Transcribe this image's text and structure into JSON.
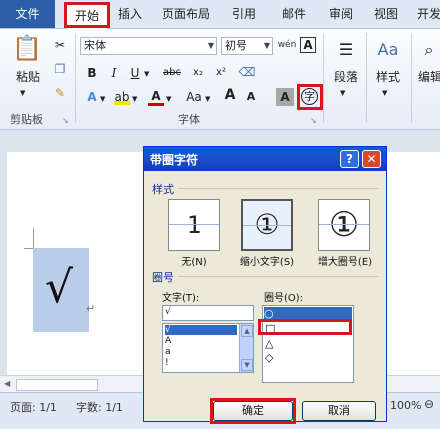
{
  "tabs": [
    "文件",
    "开始",
    "插入",
    "页面布局",
    "引用",
    "邮件",
    "审阅",
    "视图",
    "开发"
  ],
  "ribbon": {
    "clipboard": {
      "paste_label": "粘贴",
      "group_label": "剪贴板"
    },
    "font": {
      "font_name": "宋体",
      "font_size": "初号",
      "wen_icon": "wén",
      "a_box_icon": "A",
      "bold": "B",
      "italic": "I",
      "underline": "U",
      "strikethrough": "abc",
      "subscript": "x₂",
      "superscript": "x²",
      "aa": "Aa",
      "grow": "A",
      "shrink": "A",
      "char_shading": "A",
      "enclose_char": "字",
      "group_label": "字体"
    },
    "paragraph_label": "段落",
    "styles_label": "样式",
    "edit_label": "编辑"
  },
  "document": {
    "selected_char": "√",
    "para_mark": "↵"
  },
  "status_bar": {
    "page": "页面: 1/1",
    "words": "字数: 1/1",
    "zoom": "100%"
  },
  "dialog": {
    "title": "带圈字符",
    "help": "?",
    "close": "✕",
    "style_section": "样式",
    "styles": [
      {
        "glyph": "1",
        "label": "无(N)"
      },
      {
        "glyph": "①",
        "label": "缩小文字(S)"
      },
      {
        "glyph": "①",
        "label": "增大圈号(E)"
      }
    ],
    "symbol_section": "圈号",
    "text_label": "文字(T):",
    "text_value": "√",
    "text_list": [
      "√",
      "A",
      "a",
      "!"
    ],
    "enclosure_label": "圈号(O):",
    "enclosure_list": [
      "○",
      "□",
      "△",
      "◇"
    ],
    "ok": "确定",
    "cancel": "取消"
  }
}
